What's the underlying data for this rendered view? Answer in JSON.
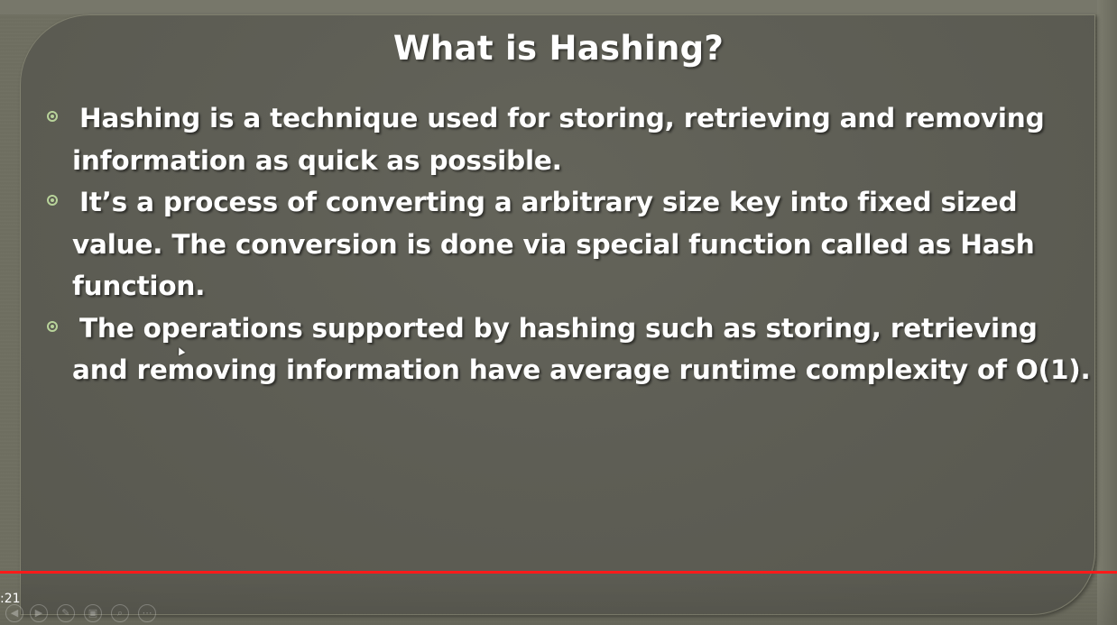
{
  "slide": {
    "title": "What is Hashing?",
    "bullets": [
      "Hashing is a technique used for storing, retrieving and removing information as quick as possible.",
      "It’s a process of converting a arbitrary size key into fixed sized value. The conversion is done via special function called as Hash function.",
      "The operations supported by hashing such as storing, retrieving and removing information have average runtime complexity of O(1)."
    ]
  },
  "player": {
    "time": ":21",
    "progress_fraction": 1.0,
    "controls": [
      {
        "icon": "prev-icon",
        "glyph": "◀"
      },
      {
        "icon": "play-icon",
        "glyph": "▶"
      },
      {
        "icon": "pen-icon",
        "glyph": "✎"
      },
      {
        "icon": "slides-icon",
        "glyph": "▣"
      },
      {
        "icon": "zoom-icon",
        "glyph": "⌕"
      },
      {
        "icon": "more-icon",
        "glyph": "⋯"
      }
    ]
  },
  "colors": {
    "background": "#5e5e55",
    "bullet_marker": "#b8d39a",
    "progress": "#e52b2b",
    "text": "#ffffff"
  }
}
